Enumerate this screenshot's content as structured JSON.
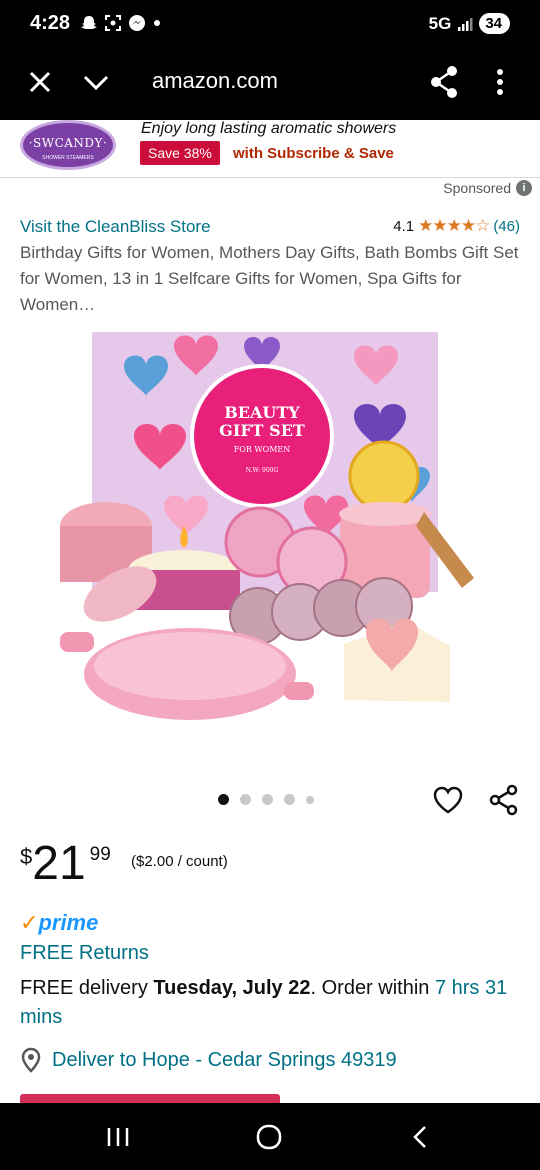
{
  "status_bar": {
    "time": "4:28",
    "network": "5G",
    "battery": "34",
    "icons": [
      "snapchat-icon",
      "screenshot-icon",
      "messenger-icon",
      "dot-icon",
      "signal-icon"
    ]
  },
  "browser": {
    "url": "amazon.com",
    "icons": [
      "close-icon",
      "chevron-down-icon",
      "share-icon",
      "more-vert-icon"
    ]
  },
  "ad": {
    "logo_text": "·SWCANDY·",
    "logo_sub": "SHOWER STEAMERS",
    "tagline": "Enjoy long lasting aromatic showers",
    "save_badge": "Save 38%",
    "subscribe_text": "with Subscribe & Save"
  },
  "sponsored": {
    "label": "Sponsored",
    "info": "i"
  },
  "product": {
    "store_link": "Visit the CleanBliss Store",
    "rating_value": "4.1",
    "rating_stars": "★★★★☆",
    "rating_count": "(46)",
    "title": "Birthday Gifts for Women, Mothers Day Gifts, Bath Bombs Gift Set for Women, 13 in 1 Selfcare Gifts for Women, Spa Gifts for Women…",
    "image": {
      "box_title_1": "BEAUTY",
      "box_title_2": "GIFT SET",
      "box_sub": "FOR WOMEN",
      "box_weight": "N.W: 900G"
    },
    "carousel": {
      "count": 5,
      "active": 0
    }
  },
  "pricing": {
    "currency": "$",
    "whole": "21",
    "fraction": "99",
    "unit_price": "($2.00 / count)"
  },
  "shipping": {
    "prime_check": "✓",
    "prime_label": "prime",
    "free_returns": "FREE Returns",
    "delivery_prefix": "FREE delivery ",
    "delivery_date": "Tuesday, July 22",
    "delivery_middle": ". Order within ",
    "delivery_window": "7 hrs 31 mins"
  },
  "location": {
    "deliver_to": "Deliver to Hope - Cedar Springs 49319"
  },
  "colors": {
    "link": "#007185",
    "deal_red": "#cc0c39",
    "star": "#de7921",
    "prime_blue": "#1a98ff"
  }
}
